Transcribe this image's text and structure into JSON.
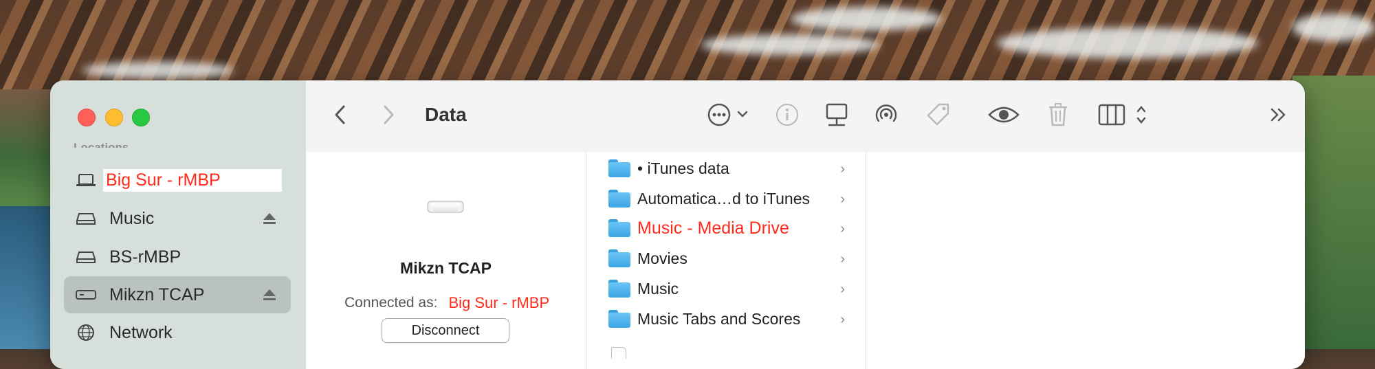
{
  "window": {
    "title": "Data"
  },
  "sidebar": {
    "section_label": "Locations",
    "items": [
      {
        "label": "Big Sur - rMBP",
        "icon": "laptop-icon",
        "redacted": true
      },
      {
        "label": "Music",
        "icon": "drive-icon",
        "eject": true
      },
      {
        "label": "BS-rMBP",
        "icon": "drive-icon"
      },
      {
        "label": "Mikzn TCAP",
        "icon": "time-capsule-icon",
        "eject": true,
        "selected": true
      },
      {
        "label": "Network",
        "icon": "globe-icon"
      }
    ]
  },
  "toolbar": {
    "icons": [
      "back-chevron-icon",
      "forward-chevron-icon",
      "ellipsis-circle-icon",
      "info-icon",
      "connect-icon",
      "airdrop-icon",
      "tag-icon",
      "quicklook-eye-icon",
      "trash-icon",
      "column-view-icon",
      "overflow-icon",
      "search-icon"
    ]
  },
  "preview": {
    "device_name": "Mikzn TCAP",
    "connected_label": "Connected as:",
    "connected_user": "Big Sur - rMBP",
    "disconnect_label": "Disconnect"
  },
  "list": {
    "rows": [
      {
        "label": "• iTunes data"
      },
      {
        "label": "Automatica…d to iTunes"
      },
      {
        "label": "Music - Media Drive",
        "highlight": true
      },
      {
        "label": "Movies"
      },
      {
        "label": "Music"
      },
      {
        "label": "Music Tabs and Scores"
      }
    ]
  },
  "colors": {
    "accent_red": "#ff2a1a",
    "folder_blue": "#3ba5e6"
  }
}
